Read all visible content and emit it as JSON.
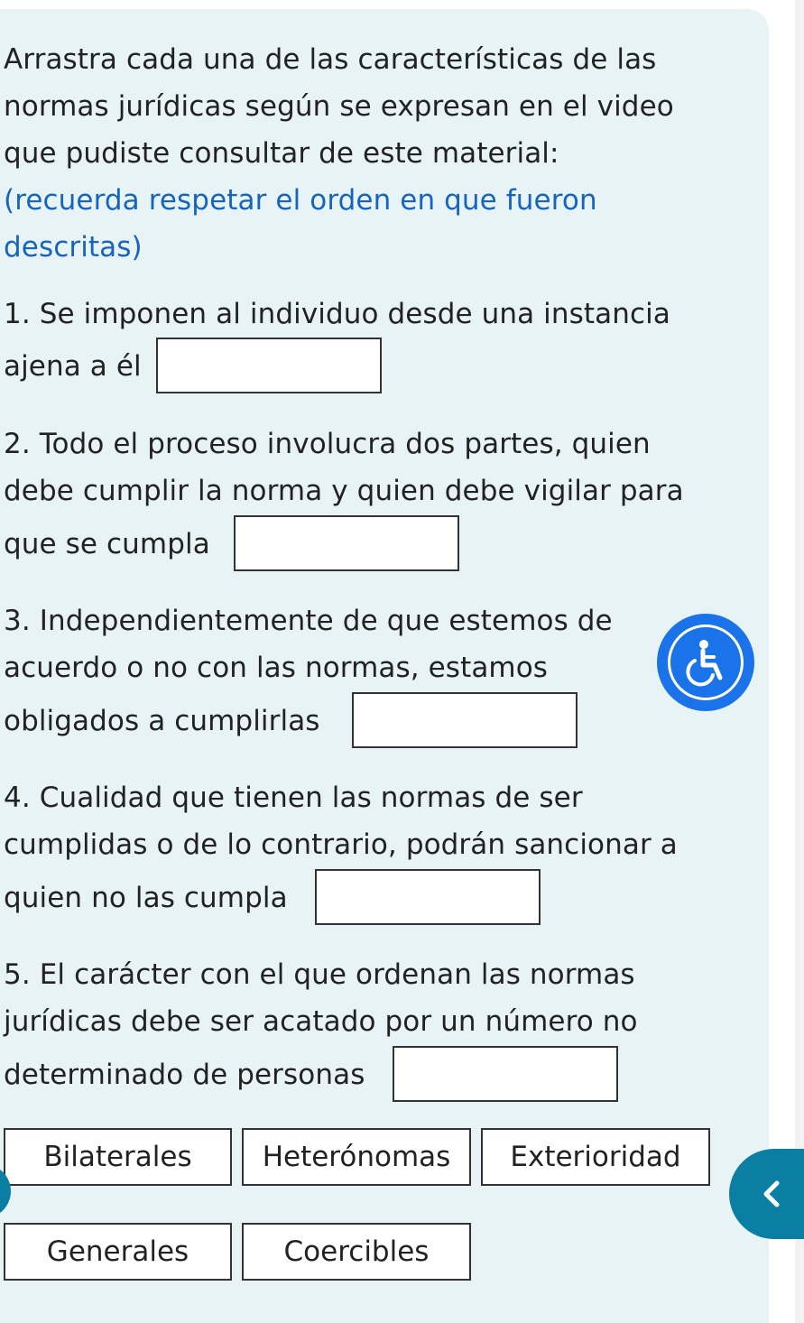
{
  "instructions": {
    "main": "Arrastra cada una de las características de las normas jurídicas según se expresan en el video que pudiste consultar de este material:",
    "hint": "(recuerda respetar el orden en que fueron descritas)"
  },
  "items": [
    {
      "lines": [
        "1. Se imponen al individuo desde una instancia",
        "ajena a él"
      ]
    },
    {
      "lines": [
        "2. Todo el proceso involucra dos partes, quien",
        "debe cumplir la norma y quien debe vigilar para",
        "que se cumpla"
      ]
    },
    {
      "lines": [
        "3. Independientemente de que estemos de",
        "acuerdo o no con las normas, estamos",
        "obligados a cumplirlas"
      ]
    },
    {
      "lines": [
        "4. Cualidad que tienen las normas de ser",
        "cumplidas o de lo contrario, podrán sancionar a",
        "quien no las cumpla"
      ]
    },
    {
      "lines": [
        "5. El carácter con el que ordenan las normas",
        "jurídicas debe ser acatado por un número no",
        "determinado de personas"
      ]
    }
  ],
  "options": [
    "Bilaterales",
    "Heterónomas",
    "Exterioridad",
    "Generales",
    "Coercibles"
  ],
  "icons": {
    "accessibility": "accessibility-icon",
    "back": "chevron-left-icon"
  },
  "colors": {
    "panel": "#e8f3f5",
    "hint": "#1565c0",
    "accessibility": "#1a73e8",
    "tab": "#0b7fa3"
  }
}
